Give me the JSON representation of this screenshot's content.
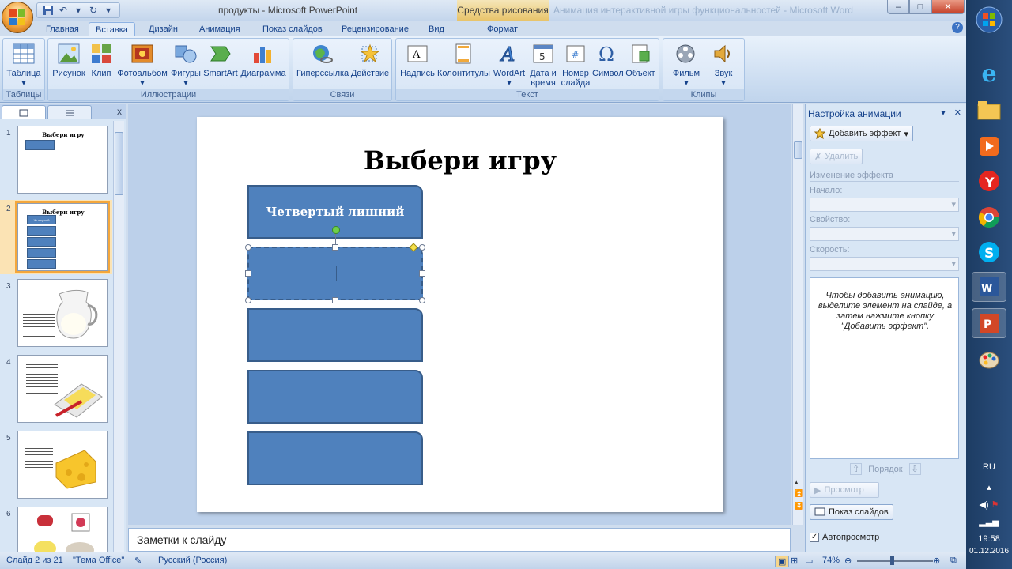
{
  "window": {
    "title": "продукты - Microsoft PowerPoint",
    "context_title": "Средства рисования",
    "context_title_behind": "Анимация интерактивной игры функциональностей - Microsoft Word",
    "min_glyph": "–",
    "max_glyph": "□",
    "close_glyph": "✕"
  },
  "tabs": [
    "Главная",
    "Вставка",
    "Дизайн",
    "Анимация",
    "Показ слайдов",
    "Рецензирование",
    "Вид",
    "Формат"
  ],
  "active_tab": "Вставка",
  "ribbon": {
    "groups": [
      {
        "label": "Таблицы",
        "buttons": [
          "Таблица"
        ]
      },
      {
        "label": "Иллюстрации",
        "buttons": [
          "Рисунок",
          "Клип",
          "Фотоальбом",
          "Фигуры",
          "SmartArt",
          "Диаграмма"
        ]
      },
      {
        "label": "Связи",
        "buttons": [
          "Гиперссылка",
          "Действие"
        ]
      },
      {
        "label": "Текст",
        "buttons": [
          "Надпись",
          "Колонтитулы",
          "WordArt",
          "Дата и время",
          "Номер слайда",
          "Символ",
          "Объект"
        ]
      },
      {
        "label": "Клипы мультимедиа",
        "buttons": [
          "Фильм",
          "Звук"
        ]
      }
    ]
  },
  "slides_panel": {
    "close": "x",
    "slides": [
      {
        "num": "1",
        "title": "Выбери игру"
      },
      {
        "num": "2",
        "title": "Выбери игру",
        "selected": true,
        "box_label": "Четвертый лишний"
      },
      {
        "num": "3"
      },
      {
        "num": "4"
      },
      {
        "num": "5"
      },
      {
        "num": "6"
      }
    ]
  },
  "slide": {
    "title": "Выбери игру",
    "box1": "Четвертый лишний"
  },
  "notes_placeholder": "Заметки к слайду",
  "task_pane": {
    "title": "Настройка анимации",
    "add_effect": "Добавить эффект",
    "delete": "Удалить",
    "change_effect": "Изменение эффекта",
    "start_label": "Начало:",
    "property_label": "Свойство:",
    "speed_label": "Скорость:",
    "hint": "Чтобы добавить анимацию, выделите элемент на слайде, а затем нажмите кнопку \"Добавить эффект\".",
    "order": "Порядок",
    "preview": "Просмотр",
    "slideshow": "Показ слайдов",
    "autopreview": "Автопросмотр"
  },
  "status": {
    "slide_info": "Слайд 2 из 21",
    "theme": "\"Тема Office\"",
    "language": "Русский (Россия)",
    "zoom": "74%"
  },
  "taskbar": {
    "lang": "RU",
    "time": "19:58",
    "date": "01.12.2016"
  }
}
